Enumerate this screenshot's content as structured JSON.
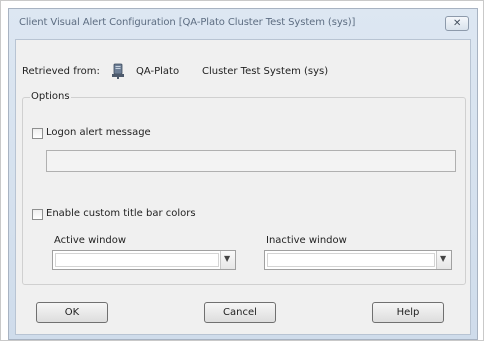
{
  "window": {
    "title": "Client Visual Alert Configuration [QA-Plato     Cluster Test System (sys)]",
    "close_glyph": "✕"
  },
  "retrieved": {
    "label": "Retrieved from:",
    "server": "QA-Plato",
    "cluster": "Cluster Test System (sys)",
    "icon": "server-icon"
  },
  "options": {
    "legend": "Options",
    "logon_alert": {
      "label": "Logon alert message",
      "checked": false,
      "value": ""
    },
    "custom_colors": {
      "label": "Enable custom title bar colors",
      "checked": false
    },
    "active_window": {
      "label": "Active window",
      "value": ""
    },
    "inactive_window": {
      "label": "Inactive window",
      "value": ""
    }
  },
  "buttons": {
    "ok": "OK",
    "cancel": "Cancel",
    "help": "Help"
  },
  "colors": {
    "dialog_frame": "#cfdceb",
    "client_bg": "#f0f0f0"
  }
}
